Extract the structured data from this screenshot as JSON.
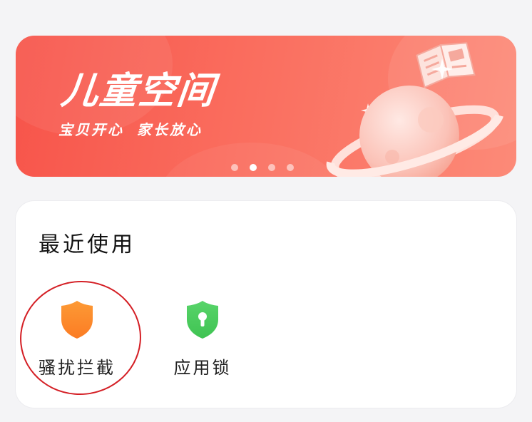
{
  "banner": {
    "title": "儿童空间",
    "subtitle": "宝贝开心  家长放心",
    "dots": [
      false,
      true,
      false,
      false
    ],
    "colors": {
      "start": "#f7544a",
      "end": "#fc8a78"
    }
  },
  "recent": {
    "title": "最近使用",
    "apps": [
      {
        "label": "骚扰拦截",
        "icon": "shield-icon",
        "color": "#fb8a2e"
      },
      {
        "label": "应用锁",
        "icon": "lock-shield-icon",
        "color": "#47cc5a"
      }
    ]
  },
  "annotation": {
    "highlight_color": "#d41e24"
  }
}
